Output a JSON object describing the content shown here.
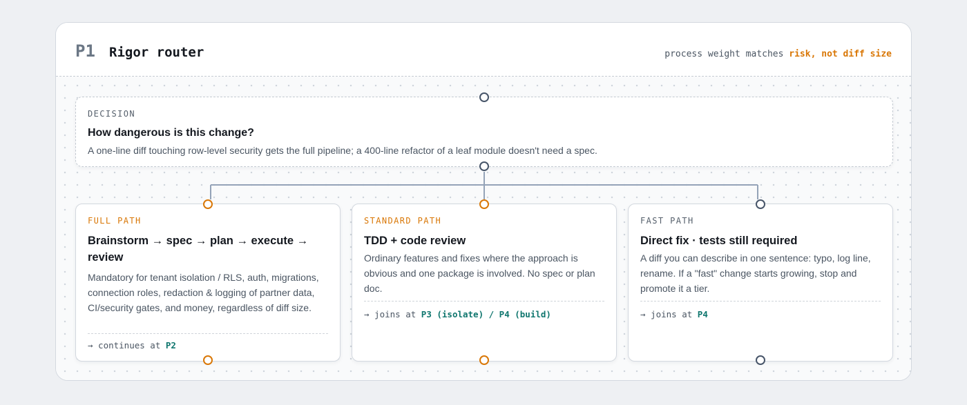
{
  "header": {
    "id": "P1",
    "title": "Rigor router",
    "tagline_prefix": "process weight matches",
    "tagline_highlight": "risk, not diff size"
  },
  "decision": {
    "label": "DECISION",
    "question": "How dangerous is this change?",
    "description": "A one-line diff touching row-level security gets the full pipeline; a 400-line refactor of a leaf module doesn't need a spec."
  },
  "paths": [
    {
      "label": "FULL PATH",
      "title": "Brainstorm → spec → plan → execute → review",
      "description": "Mandatory for tenant isolation / RLS, auth, migrations, connection roles, redaction & logging of partner data, CI/security gates, and money, regardless of diff size.",
      "footer_prefix": "→ continues at",
      "footer_target": "P2",
      "accent": "#d97706"
    },
    {
      "label": "STANDARD PATH",
      "title": "TDD + code review",
      "description": "Ordinary features and fixes where the approach is obvious and one package is involved. No spec or plan doc.",
      "footer_prefix": "→ joins at",
      "footer_target": "P3 (isolate) / P4 (build)",
      "accent": "#d97706"
    },
    {
      "label": "FAST PATH",
      "title": "Direct fix · tests still required",
      "description": "A diff you can describe in one sentence: typo, log line, rename. If a \"fast\" change starts growing, stop and promote it a tier.",
      "footer_prefix": "→ joins at",
      "footer_target": "P4",
      "accent": "#475569"
    }
  ],
  "colors": {
    "accent_orange": "#d97706",
    "link_teal": "#0f766e",
    "connector_gray": "#94a3b8",
    "port_dark": "#475569"
  }
}
